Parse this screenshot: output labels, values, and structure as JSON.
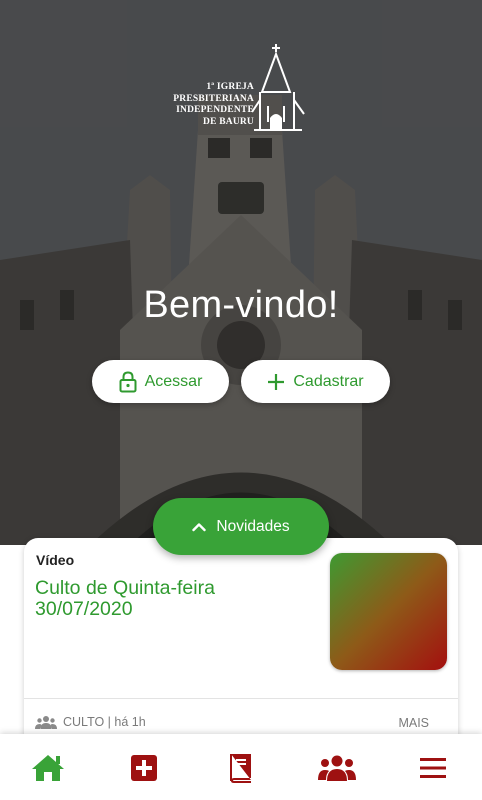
{
  "logo": {
    "lines": [
      "1ª IGREJA",
      "PRESBITERIANA",
      "INDEPENDENTE",
      "DE BAURU"
    ],
    "icon": "church-tower-icon"
  },
  "hero": {
    "welcome": "Bem-vindo!",
    "access_label": "Acessar",
    "access_icon": "lock-icon",
    "register_label": "Cadastrar",
    "register_icon": "plus-icon"
  },
  "news_toggle": {
    "label": "Novidades",
    "icon": "chevron-up-icon"
  },
  "news_card": {
    "type": "Vídeo",
    "title": "Culto de Quinta-feira 30/07/2020",
    "meta": "CULTO | há 1h",
    "meta_icon": "users-icon",
    "more": "MAIS"
  },
  "bottom_nav": {
    "items": [
      {
        "icon": "home-icon",
        "active": true
      },
      {
        "icon": "medical-cross-icon",
        "active": false
      },
      {
        "icon": "bible-icon",
        "active": false
      },
      {
        "icon": "group-icon",
        "active": false
      },
      {
        "icon": "menu-icon",
        "active": false
      }
    ]
  },
  "colors": {
    "green": "#39a338",
    "green_text": "#2f9a2f",
    "red": "#9e1111",
    "white": "#ffffff"
  }
}
